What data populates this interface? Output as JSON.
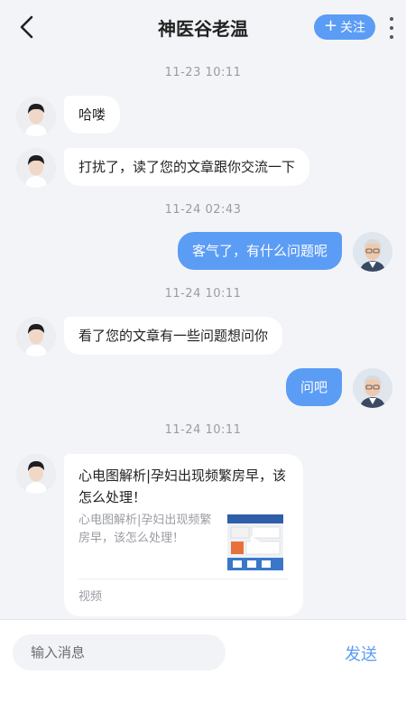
{
  "header": {
    "title": "神医谷老温",
    "follow_label": "关注",
    "follow_icon": "plus-icon",
    "back_icon": "back-arrow-icon",
    "more_icon": "more-vertical-icon"
  },
  "colors": {
    "accent": "#5b9cf5",
    "background": "#f3f4f8",
    "incoming_bubble": "#ffffff",
    "timestamp": "#9a9ca3"
  },
  "messages": {
    "ts1": "11-23 10:11",
    "m1": "哈喽",
    "m2": "打扰了，读了您的文章跟你交流一下",
    "ts2": "11-24 02:43",
    "m3": "客气了，有什么问题呢",
    "ts3": "11-24 10:11",
    "m4": "看了您的文章有一些问题想问你",
    "m5": "问吧",
    "ts4": "11-24 10:11",
    "card": {
      "title": "心电图解析|孕妇出现频繁房早，该怎么处理！",
      "desc": "心电图解析|孕妇出现频繁房早，该怎么处理！",
      "type_label": "视频",
      "thumb_icon": "video-thumbnail-icon"
    }
  },
  "input": {
    "placeholder": "输入消息",
    "send_label": "发送"
  }
}
